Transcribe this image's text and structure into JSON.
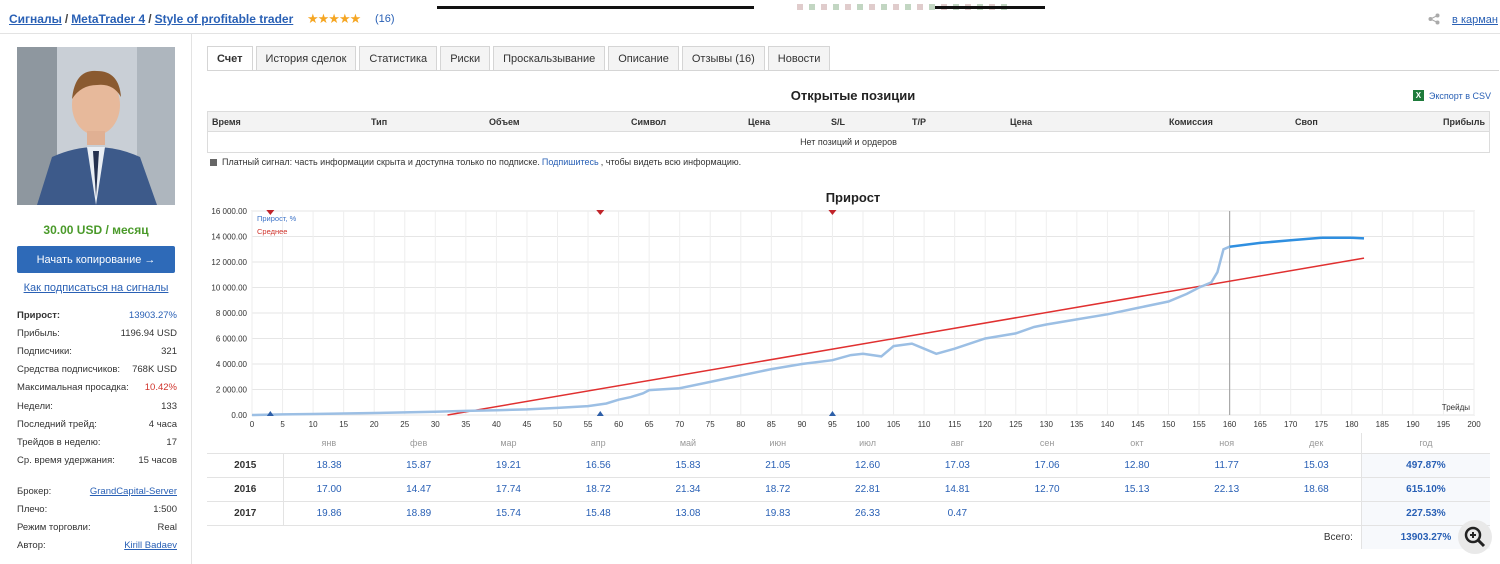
{
  "breadcrumb": {
    "items": [
      "Сигналы",
      "MetaTrader 4",
      "Style of profitable trader"
    ],
    "separator": "/"
  },
  "rating": {
    "stars": "★★★★★",
    "value": 4.5,
    "count": "(16)"
  },
  "wallet_link": "в карман",
  "sidebar": {
    "price": "30.00 USD / месяц",
    "copy_button": "Начать копирование →",
    "howto_link": "Как подписаться на сигналы",
    "stats": [
      {
        "label": "Прирост:",
        "value": "13903.27%"
      },
      {
        "label": "Прибыль:",
        "value": "1196.94 USD"
      },
      {
        "label": "Подписчики:",
        "value": "321"
      },
      {
        "label": "Средства подписчиков:",
        "value": "768K USD"
      },
      {
        "label": "Максимальная просадка:",
        "value": "10.42%"
      },
      {
        "label": "Недели:",
        "value": "133"
      },
      {
        "label": "Последний трейд:",
        "value": "4 часа"
      },
      {
        "label": "Трейдов в неделю:",
        "value": "17"
      },
      {
        "label": "Ср. время удержания:",
        "value": "15 часов"
      }
    ],
    "info": [
      {
        "label": "Брокер:",
        "value": "GrandCapital-Server"
      },
      {
        "label": "Плечо:",
        "value": "1:500"
      },
      {
        "label": "Режим торговли:",
        "value": "Real"
      },
      {
        "label": "Автор:",
        "value": "Kirill Badaev"
      }
    ]
  },
  "tabs": [
    "Счет",
    "История сделок",
    "Статистика",
    "Риски",
    "Проскальзывание",
    "Описание",
    "Отзывы (16)",
    "Новости"
  ],
  "open_positions": {
    "title": "Открытые позиции",
    "export": "Экспорт в CSV",
    "export_icon": "excel-icon",
    "columns": [
      "Время",
      "Тип",
      "Объем",
      "Символ",
      "Цена",
      "S/L",
      "T/P",
      "Цена",
      "Комиссия",
      "Своп",
      "Прибыль"
    ],
    "empty": "Нет позиций и ордеров",
    "note_pre": "Платный сигнал: часть информации скрыта и доступна только по подписке.",
    "note_link": "Подпишитесь",
    "note_post": ", чтобы видеть всю информацию."
  },
  "growth": {
    "title": "Прирост"
  },
  "chart_data": {
    "type": "line",
    "title": "Прирост",
    "xlabel": "Трейды",
    "ylabel": "",
    "xlim": [
      0,
      200
    ],
    "ylim": [
      0,
      16000
    ],
    "x_ticks": [
      0,
      5,
      10,
      15,
      20,
      25,
      30,
      35,
      40,
      45,
      50,
      55,
      60,
      65,
      70,
      75,
      80,
      85,
      90,
      95,
      100,
      105,
      110,
      115,
      120,
      125,
      130,
      135,
      140,
      145,
      150,
      155,
      160,
      165,
      170,
      175,
      180,
      185,
      190,
      195,
      200
    ],
    "y_ticks": [
      0,
      2000,
      4000,
      6000,
      8000,
      10000,
      12000,
      14000,
      16000
    ],
    "y_tick_labels": [
      "0.00",
      "2 000.00",
      "4 000.00",
      "6 000.00",
      "8 000.00",
      "10 000.00",
      "12 000.00",
      "14 000.00",
      "16 000.00"
    ],
    "legend": [
      "Прирост, %",
      "Среднее"
    ],
    "legend_placement": "top-left",
    "grid": true,
    "colors": {
      "growth": "#9cbfe4",
      "growth_recent": "#2f8fe0",
      "average": "#e03030"
    },
    "series": [
      {
        "name": "Прирост, %",
        "x": [
          0,
          5,
          10,
          15,
          20,
          25,
          30,
          35,
          40,
          45,
          50,
          55,
          58,
          60,
          62,
          64,
          65,
          70,
          75,
          80,
          85,
          90,
          95,
          98,
          100,
          103,
          105,
          108,
          110,
          112,
          115,
          120,
          125,
          128,
          130,
          135,
          140,
          145,
          150,
          153,
          155,
          157,
          158,
          159,
          160,
          165,
          170,
          175,
          180,
          182
        ],
        "y": [
          0,
          50,
          80,
          120,
          160,
          200,
          260,
          320,
          380,
          440,
          560,
          700,
          900,
          1200,
          1400,
          1700,
          1950,
          2100,
          2600,
          3100,
          3600,
          4000,
          4300,
          4700,
          4800,
          4600,
          5400,
          5600,
          5200,
          4800,
          5200,
          6000,
          6400,
          6900,
          7100,
          7500,
          7900,
          8400,
          8900,
          9500,
          10000,
          10400,
          11200,
          13000,
          13200,
          13500,
          13700,
          13900,
          13900,
          13850
        ]
      },
      {
        "name": "Среднее",
        "x": [
          32,
          182
        ],
        "y": [
          0,
          12300
        ]
      }
    ],
    "markers_top": [
      3,
      57,
      95
    ],
    "markers_bottom": [
      3,
      57,
      95
    ],
    "vertical_line_x": 160
  },
  "monthly": {
    "headers": [
      "янв",
      "фев",
      "мар",
      "апр",
      "май",
      "июн",
      "июл",
      "авг",
      "сен",
      "окт",
      "ноя",
      "дек",
      "год"
    ],
    "rows": [
      {
        "year": "2015",
        "values": [
          "18.38",
          "15.87",
          "19.21",
          "16.56",
          "15.83",
          "21.05",
          "12.60",
          "17.03",
          "17.06",
          "12.80",
          "11.77",
          "15.03"
        ],
        "total": "497.87%"
      },
      {
        "year": "2016",
        "values": [
          "17.00",
          "14.47",
          "17.74",
          "18.72",
          "21.34",
          "18.72",
          "22.81",
          "14.81",
          "12.70",
          "15.13",
          "22.13",
          "18.68"
        ],
        "total": "615.10%"
      },
      {
        "year": "2017",
        "values": [
          "19.86",
          "18.89",
          "15.74",
          "15.48",
          "13.08",
          "19.83",
          "26.33",
          "0.47",
          "",
          "",
          "",
          ""
        ],
        "total": "227.53%"
      }
    ],
    "sum_label": "Всего:",
    "sum_total": "13903.27%"
  },
  "zoom_icon": "zoom-in-icon"
}
